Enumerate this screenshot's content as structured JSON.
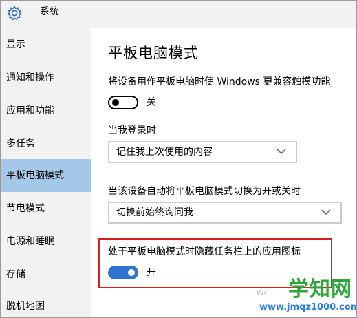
{
  "header": {
    "app_title": "系统",
    "icon": "gear-icon"
  },
  "sidebar": {
    "items": [
      {
        "label": "显示",
        "active": false
      },
      {
        "label": "通知和操作",
        "active": false
      },
      {
        "label": "应用和功能",
        "active": false
      },
      {
        "label": "多任务",
        "active": false
      },
      {
        "label": "平板电脑模式",
        "active": true
      },
      {
        "label": "节电模式",
        "active": false
      },
      {
        "label": "电源和睡眠",
        "active": false
      },
      {
        "label": "存储",
        "active": false
      },
      {
        "label": "脱机地图",
        "active": false
      }
    ]
  },
  "main": {
    "title": "平板电脑模式",
    "touch_setting": {
      "label": "将设备用作平板电脑时使 Windows 更兼容触摸功能",
      "state_text": "关",
      "on": false
    },
    "login_setting": {
      "label": "当我登录时",
      "selected": "记住我上次使用的内容"
    },
    "switch_setting": {
      "label": "当该设备自动将平板电脑模式切换为开或关时",
      "selected": "切换前始终询问我"
    },
    "hide_icons_setting": {
      "label": "处于平板电脑模式时隐藏任务栏上的应用图标",
      "state_text": "开",
      "on": true
    }
  },
  "watermark": {
    "main": "学知网",
    "sub": "www.jmqz1000.com",
    "fragment": "Wi"
  },
  "colors": {
    "accent": "#2e74d1",
    "active_nav": "#a5c8e8",
    "highlight": "#d81e1e",
    "watermark_green": "#2fa63b",
    "watermark_blue": "#2f7fd8"
  }
}
